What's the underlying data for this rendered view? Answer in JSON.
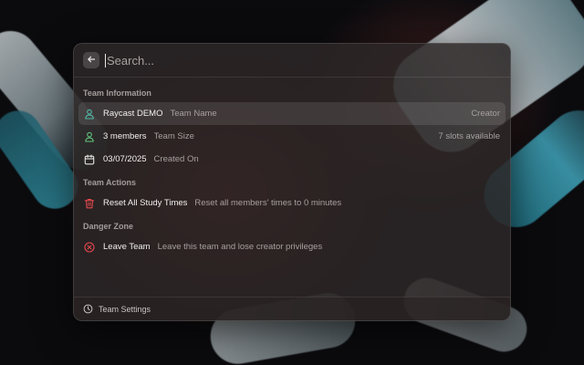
{
  "search": {
    "placeholder": "Search..."
  },
  "sections": {
    "team_information": "Team Information",
    "team_actions": "Team Actions",
    "danger_zone": "Danger Zone"
  },
  "rows": {
    "team_name": {
      "title": "Raycast DEMO",
      "subtitle": "Team Name",
      "accessory": "Creator",
      "icon": "person-icon"
    },
    "team_size": {
      "title": "3 members",
      "subtitle": "Team Size",
      "accessory": "7 slots available",
      "icon": "person-icon"
    },
    "created_on": {
      "title": "03/07/2025",
      "subtitle": "Created On",
      "icon": "calendar-icon"
    },
    "reset_times": {
      "title": "Reset All Study Times",
      "subtitle": "Reset all members' times to 0 minutes",
      "icon": "trash-icon"
    },
    "leave_team": {
      "title": "Leave Team",
      "subtitle": "Leave this team and lose creator privileges",
      "icon": "x-circle-icon"
    }
  },
  "footer": {
    "label": "Team Settings",
    "icon": "clock-icon"
  },
  "colors": {
    "teal_icon": "#4fb8a5",
    "green_icon": "#5fc27a",
    "red_icon": "#e5484d",
    "text_primary": "#f2efef",
    "text_secondary": "#a6a09f"
  }
}
